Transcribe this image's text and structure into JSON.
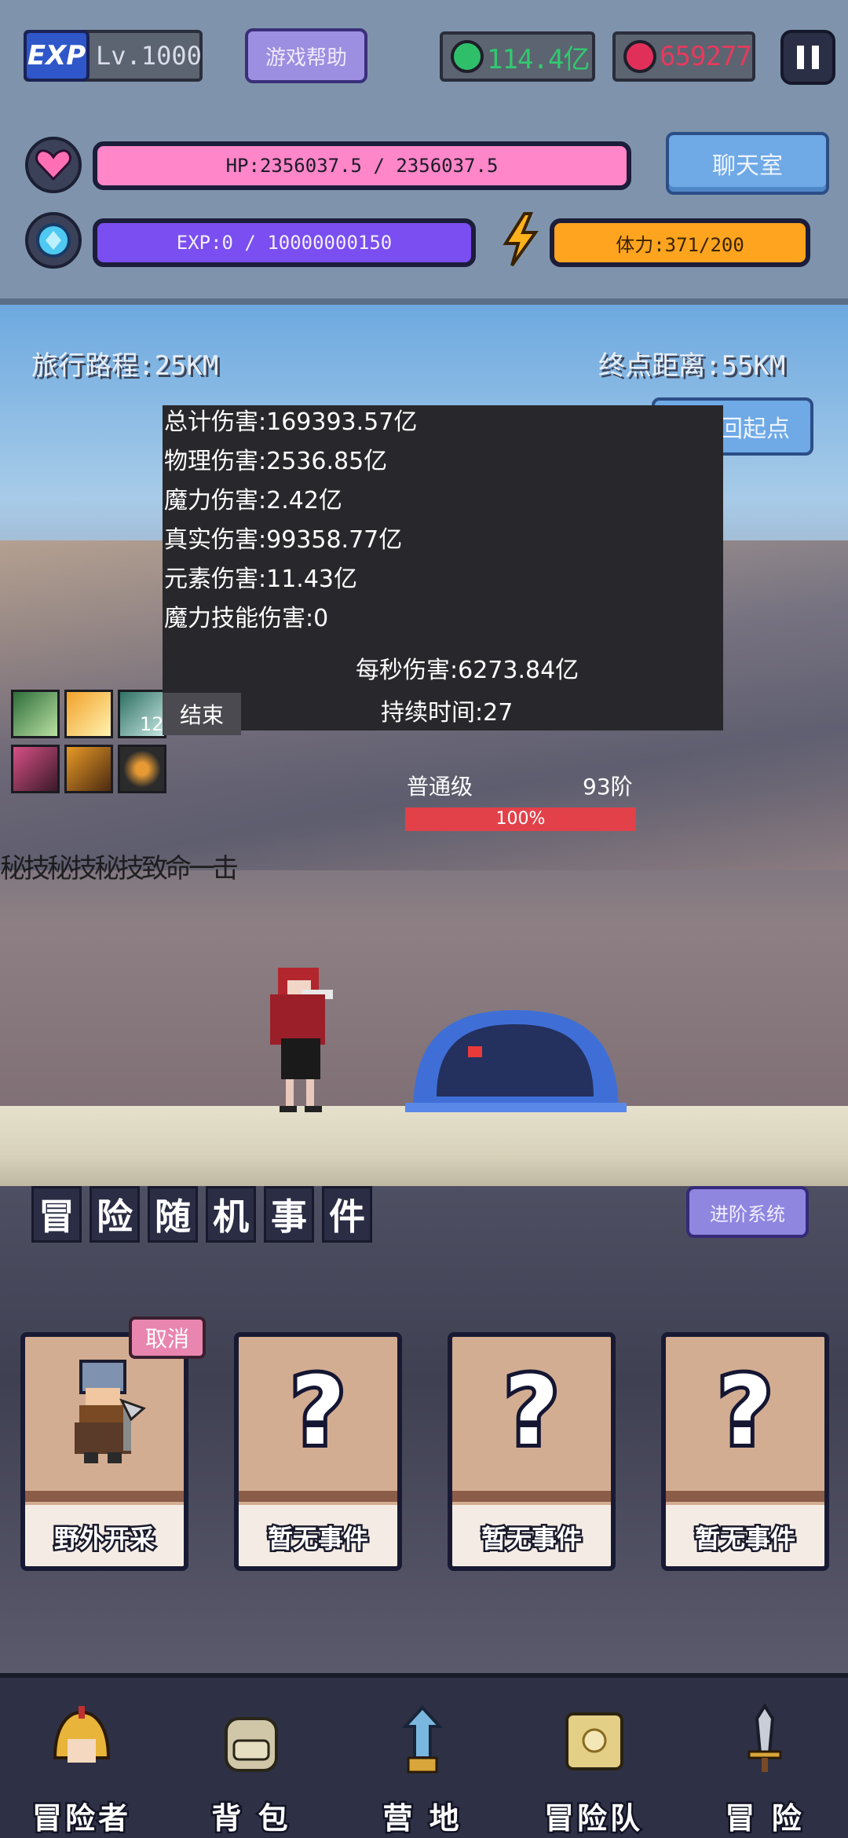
{
  "hud": {
    "exp_logo": "EXP",
    "level": "Lv.1000",
    "help_button": "游戏帮助",
    "emerald": {
      "value": "114.4亿",
      "color": "#2fbf6a"
    },
    "ruby": {
      "value": "659277",
      "color": "#e0305a"
    },
    "hp_text": "HP:2356037.5 / 2356037.5",
    "exp_text": "EXP:0 / 10000000150",
    "stamina_text": "体力:371/200",
    "chat_button": "聊天室"
  },
  "scene": {
    "travel_distance": "旅行路程:25KM",
    "end_distance": "终点距离:55KM",
    "back_button": "回起点",
    "damage": {
      "total": "总计伤害:169393.57亿",
      "physical": "物理伤害:2536.85亿",
      "magic": "魔力伤害:2.42亿",
      "true": "真实伤害:99358.77亿",
      "element": "元素伤害:11.43亿",
      "magic_skill": "魔力技能伤害:0",
      "dps": "每秒伤害:6273.84亿",
      "duration": "持续时间:27",
      "end_button": "结束"
    },
    "skill_count": "12",
    "enemy": {
      "grade": "普通级",
      "tier": "93阶",
      "hp_percent": 100,
      "hp_label": "100%"
    },
    "floating_text": "秘技秘技秘技致命一击"
  },
  "events": {
    "title": [
      "冒",
      "险",
      "随",
      "机",
      "事",
      "件"
    ],
    "advance_button": "进阶系统",
    "cancel_button": "取消",
    "cards": [
      {
        "label": "野外开采",
        "icon": "miner-icon"
      },
      {
        "label": "暂无事件",
        "icon": "question-icon"
      },
      {
        "label": "暂无事件",
        "icon": "question-icon"
      },
      {
        "label": "暂无事件",
        "icon": "question-icon"
      }
    ]
  },
  "nav": {
    "items": [
      {
        "label": "冒险者",
        "icon": "helmet-icon"
      },
      {
        "label": "背 包",
        "icon": "backpack-icon"
      },
      {
        "label": "营 地",
        "icon": "camp-icon"
      },
      {
        "label": "冒险队",
        "icon": "book-icon"
      },
      {
        "label": "冒 险",
        "icon": "sword-icon"
      }
    ]
  }
}
